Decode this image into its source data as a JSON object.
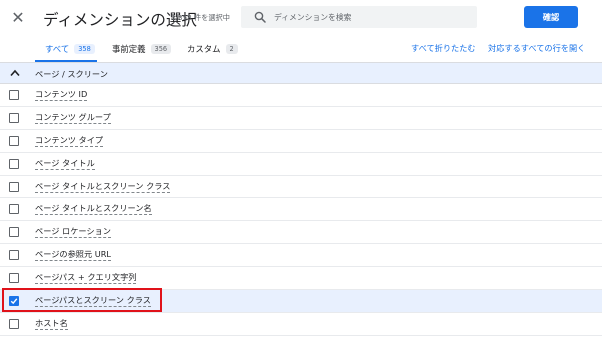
{
  "header": {
    "close_icon": "close-icon",
    "title": "ディメンションの選択",
    "selection_count": "1/358 件を選択中",
    "search": {
      "placeholder": "ディメンションを検索",
      "value": ""
    },
    "confirm_label": "確認"
  },
  "tabs": [
    {
      "label": "すべて",
      "count": "358",
      "active": true
    },
    {
      "label": "事前定義",
      "count": "356",
      "active": false
    },
    {
      "label": "カスタム",
      "count": "2",
      "active": false
    }
  ],
  "actions": {
    "collapse_all": "すべて折りたたむ",
    "expand_rows": "対応するすべての行を開く"
  },
  "group": {
    "label": "ページ / スクリーン",
    "icon": "chevron-up-icon"
  },
  "rows": [
    {
      "label": "コンテンツ ID",
      "checked": false
    },
    {
      "label": "コンテンツ グループ",
      "checked": false
    },
    {
      "label": "コンテンツ タイプ",
      "checked": false
    },
    {
      "label": "ページ タイトル",
      "checked": false
    },
    {
      "label": "ページ タイトルとスクリーン クラス",
      "checked": false
    },
    {
      "label": "ページ タイトルとスクリーン名",
      "checked": false
    },
    {
      "label": "ページ ロケーション",
      "checked": false
    },
    {
      "label": "ページの参照元 URL",
      "checked": false
    },
    {
      "label": "ページパス + クエリ文字列",
      "checked": false
    },
    {
      "label": "ページパスとスクリーン クラス",
      "checked": true
    },
    {
      "label": "ホスト名",
      "checked": false
    }
  ],
  "colors": {
    "accent": "#1a73e8",
    "highlight_box": "#e0121a",
    "selected_row_bg": "#e8f0fe"
  }
}
